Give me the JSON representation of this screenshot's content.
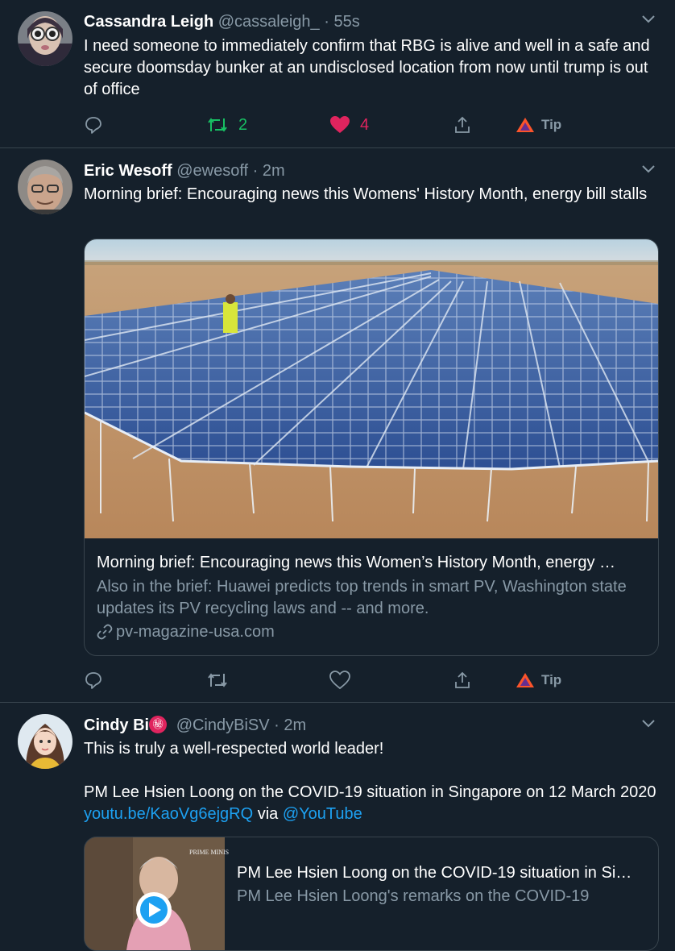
{
  "tweets": [
    {
      "name": "Cassandra Leigh",
      "handle": "@cassaleigh_",
      "sep": "·",
      "time": "55s",
      "text": "I need someone to immediately confirm that RBG is alive and well in a safe and secure doomsday bunker at an undisclosed location from now until trump is out of office",
      "retweets": "2",
      "likes": "4",
      "tip": "Tip"
    },
    {
      "name": "Eric Wesoff",
      "handle": "@ewesoff",
      "sep": "·",
      "time": "2m",
      "text": "Morning brief: Encouraging news this Womens' History Month, energy bill stalls",
      "card": {
        "title": "Morning brief: Encouraging news this Women’s History Month, energy …",
        "description": "Also in the brief: Huawei predicts top trends in smart PV, Washington state updates its PV recycling laws and -- and more.",
        "domain": "pv-magazine-usa.com"
      },
      "tip": "Tip"
    },
    {
      "name": "Cindy Bi",
      "name_badge": "㊙",
      "handle": "@CindyBiSV",
      "sep": "·",
      "time": "2m",
      "text_line1": "This is truly a well-respected world leader!",
      "text_line2": "PM Lee Hsien Loong on the COVID-19 situation in Singapore on 12 March 2020",
      "link": "youtu.be/KaoVg6ejgRQ",
      "via": "via",
      "mention": "@YouTube",
      "card": {
        "title": "PM Lee Hsien Loong on the COVID-19 situation in Si…",
        "description": "PM Lee Hsien Loong's remarks on the COVID-19",
        "thumb_text": "PRIME MINIS"
      }
    }
  ],
  "colors": {
    "background": "#15202b",
    "secondary_text": "#8899a6",
    "border": "#38444d",
    "retweet_green": "#17bf63",
    "like_red": "#e0245e",
    "link_blue": "#1da1f2"
  },
  "icons": [
    "reply-icon",
    "retweet-icon",
    "like-icon",
    "share-icon",
    "tip-icon",
    "chevron-down-icon",
    "link-icon",
    "play-icon"
  ]
}
